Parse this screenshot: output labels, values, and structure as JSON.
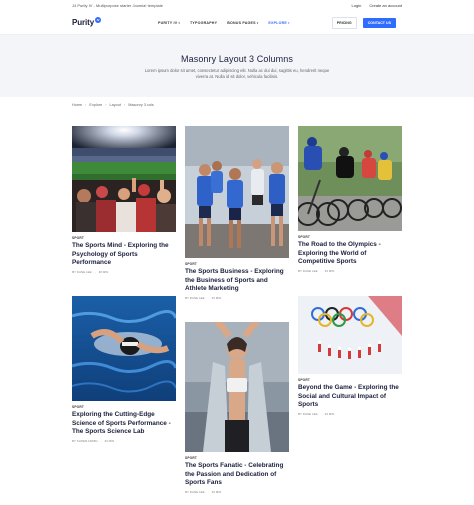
{
  "topbar": {
    "tagline": "J4 Purity IV - Multipurpose starter Joomla! template",
    "login": "Login",
    "create_account": "Create an account"
  },
  "header": {
    "logo_text": "Purity",
    "logo_badge": "IV",
    "nav": [
      {
        "label": "PURITY IV",
        "caret": "▾"
      },
      {
        "label": "TYPOGRAPHY",
        "caret": ""
      },
      {
        "label": "BONUS PAGES",
        "caret": "▾"
      },
      {
        "label": "EXPLORE",
        "caret": "▾"
      }
    ],
    "pricing": "PRICING",
    "contact": "CONTACT US"
  },
  "hero": {
    "title": "Masonry Layout 3 Columns",
    "text": "Lorem ipsum dolor sit amet, consectetur adipiscing elit. Nulla ac dui dui, sagittis eu, hendrerit neque viverra at. Nulla id sit dolor, vehicula facilisis."
  },
  "breadcrumb": [
    "Home",
    "Explore",
    "Layout",
    "Masonry 3 cols"
  ],
  "cards": [
    {
      "category": "SPORT",
      "title": "The Sports Mind - Exploring the Psychology of Sports Performance",
      "author": "BY DANE LEE",
      "time": "48 MIN"
    },
    {
      "category": "SPORT",
      "title": "The Sports Business - Exploring the Business of Sports and Athlete Marketing",
      "author": "BY DANE LEE",
      "time": "33 MIN"
    },
    {
      "category": "SPORT",
      "title": "The Road to the Olympics - Exploring the World of Competitive Sports",
      "author": "BY DANE LEE",
      "time": "33 MIN"
    },
    {
      "category": "SPORT",
      "title": "Exploring the Cutting-Edge Science of Sports Performance - The Sports Science Lab",
      "author": "BY SUPER ADMIN",
      "time": "33 MIN"
    },
    {
      "category": "SPORT",
      "title": "Beyond the Game - Exploring the Social and Cultural Impact of Sports",
      "author": "BY DANE LEE",
      "time": "33 MIN"
    },
    {
      "category": "SPORT",
      "title": "The Sports Fanatic - Celebrating the Passion and Dedication of Sports Fans",
      "author": "BY DANE LEE",
      "time": "33 MIN"
    }
  ]
}
